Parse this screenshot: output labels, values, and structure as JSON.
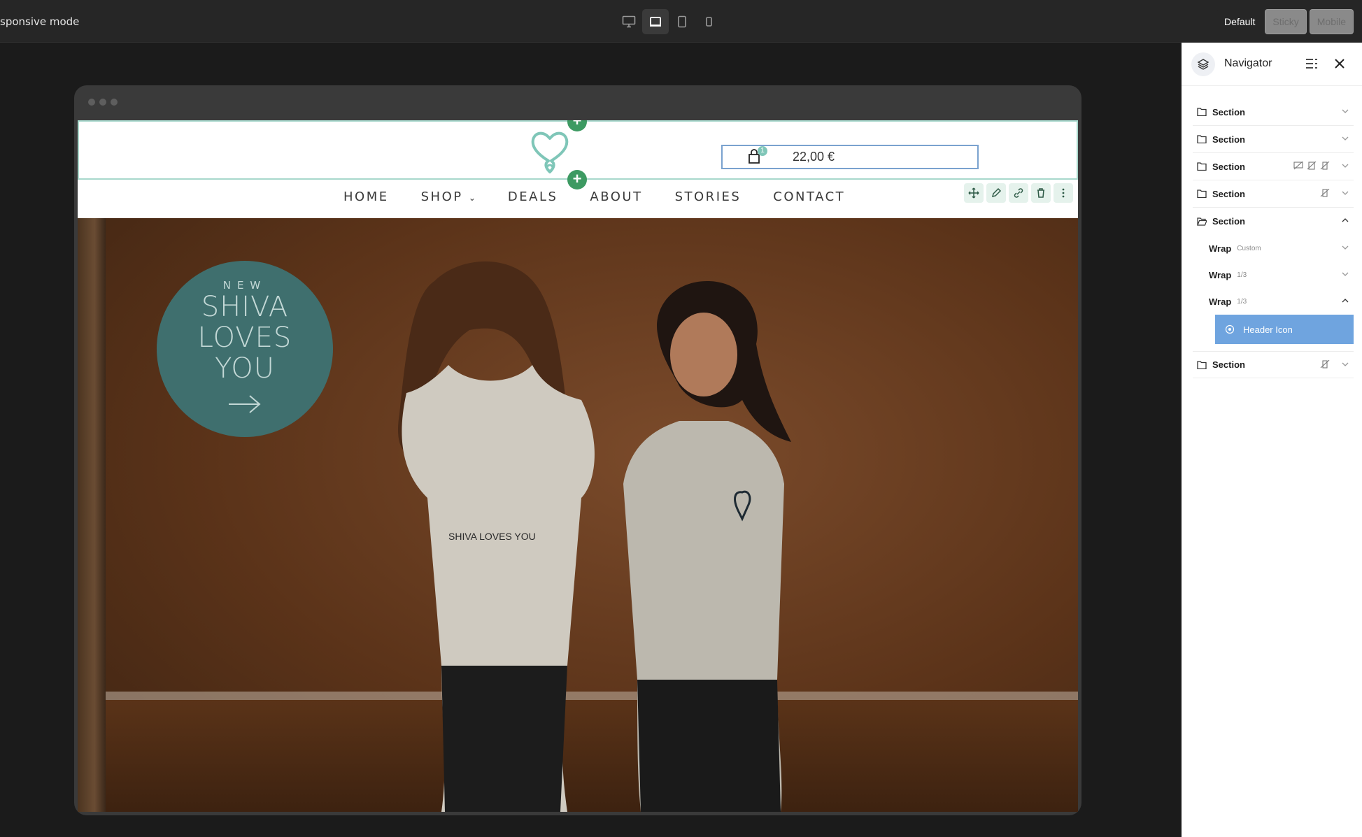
{
  "topbar": {
    "mode_label": "sponsive mode",
    "devices": [
      "desktop-large",
      "desktop",
      "tablet",
      "mobile"
    ],
    "states": {
      "default": "Default",
      "sticky": "Sticky",
      "mobile": "Mobile"
    }
  },
  "site": {
    "cart": {
      "count": "1",
      "total": "22,00 €"
    },
    "nav": {
      "home": "HOME",
      "shop": "SHOP",
      "deals": "DEALS",
      "about": "ABOUT",
      "stories": "STORIES",
      "contact": "CONTACT"
    },
    "hero": {
      "badge_new": "NEW",
      "badge_line1": "SHIVA",
      "badge_line2": "LOVES",
      "badge_line3": "YOU",
      "shirt_text": "SHIVA LOVES YOU"
    },
    "colors": {
      "accent": "#3d9a62",
      "badge": "#3f6f6e",
      "logo": "#7fc6b8"
    }
  },
  "navigator": {
    "title": "Navigator",
    "rows": {
      "s1": "Section",
      "s2": "Section",
      "s3": "Section",
      "s4": "Section",
      "s5": "Section",
      "w1": "Wrap",
      "w1_tag": "Custom",
      "w2": "Wrap",
      "w2_tag": "1/3",
      "w3": "Wrap",
      "w3_tag": "1/3",
      "selected": "Header Icon",
      "s6": "Section"
    }
  }
}
